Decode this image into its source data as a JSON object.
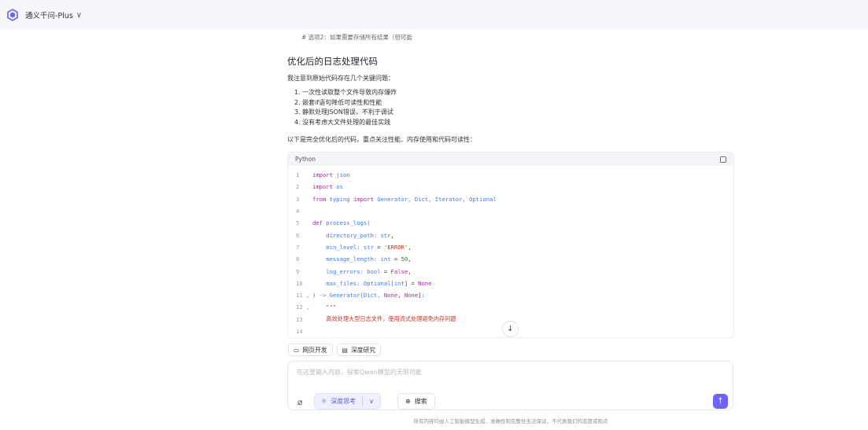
{
  "header": {
    "model_name": "通义千问-Plus",
    "colors": {
      "accent": "#6d64f5",
      "topbar": "#f6f7fb"
    }
  },
  "chat": {
    "faded_line": "# 选项2：如果需要存储所有结果（但可能",
    "heading": "优化后的日志处理代码",
    "intro": "我注意到原始代码存在几个关键问题：",
    "issues": [
      "1. 一次性读取整个文件导致内存爆炸",
      "2. 嵌套if语句降低可读性和性能",
      "3. 静默处理JSON错误，不利于调试",
      "4. 没有考虑大文件处理的最佳实践"
    ],
    "summary": "以下是完全优化后的代码，重点关注性能、内存使用和代码可读性："
  },
  "code": {
    "language": "Python",
    "lines": [
      {
        "no": "1",
        "parts": [
          {
            "t": "import",
            "c": "kw"
          },
          {
            "t": " json",
            "c": "ty"
          }
        ]
      },
      {
        "no": "2",
        "parts": [
          {
            "t": "import",
            "c": "kw"
          },
          {
            "t": " os",
            "c": "ty"
          }
        ]
      },
      {
        "no": "3",
        "parts": [
          {
            "t": "from",
            "c": "kw"
          },
          {
            "t": " typing ",
            "c": "ty"
          },
          {
            "t": "import",
            "c": "kw"
          },
          {
            "t": " Generator, Dict, Iterator, Optional",
            "c": "ty"
          }
        ]
      },
      {
        "no": "4",
        "parts": []
      },
      {
        "no": "5",
        "parts": [
          {
            "t": "def",
            "c": "kw"
          },
          {
            "t": " process_logs(",
            "c": "ty"
          }
        ]
      },
      {
        "no": "6",
        "parts": [
          {
            "t": "    directory_path: ",
            "c": "ty"
          },
          {
            "t": "str",
            "c": "ty"
          },
          {
            "t": ",",
            "c": "tx"
          }
        ]
      },
      {
        "no": "7",
        "parts": [
          {
            "t": "    min_level: ",
            "c": "ty"
          },
          {
            "t": "str",
            "c": "ty"
          },
          {
            "t": " = ",
            "c": "tx"
          },
          {
            "t": "'ERROR'",
            "c": "st"
          },
          {
            "t": ",",
            "c": "tx"
          }
        ]
      },
      {
        "no": "8",
        "parts": [
          {
            "t": "    message_length: ",
            "c": "ty"
          },
          {
            "t": "int",
            "c": "ty"
          },
          {
            "t": " = ",
            "c": "tx"
          },
          {
            "t": "50",
            "c": "nm"
          },
          {
            "t": ",",
            "c": "tx"
          }
        ]
      },
      {
        "no": "9",
        "parts": [
          {
            "t": "    log_errors: ",
            "c": "ty"
          },
          {
            "t": "bool",
            "c": "ty"
          },
          {
            "t": " = ",
            "c": "tx"
          },
          {
            "t": "False",
            "c": "kw"
          },
          {
            "t": ",",
            "c": "tx"
          }
        ]
      },
      {
        "no": "10",
        "parts": [
          {
            "t": "    max_files: Optional[",
            "c": "ty"
          },
          {
            "t": "int",
            "c": "ty"
          },
          {
            "t": "] = ",
            "c": "tx"
          },
          {
            "t": "None",
            "c": "kw"
          }
        ]
      },
      {
        "no": "11 ⌄",
        "parts": [
          {
            "t": ") -> Generator[Dict, ",
            "c": "ty"
          },
          {
            "t": "None",
            "c": "kw"
          },
          {
            "t": ", ",
            "c": "tx"
          },
          {
            "t": "None",
            "c": "kw"
          },
          {
            "t": "]:",
            "c": "tx"
          }
        ]
      },
      {
        "no": "12 ⌄",
        "parts": [
          {
            "t": "    \"\"\"",
            "c": "st"
          }
        ]
      },
      {
        "no": "13",
        "parts": [
          {
            "t": "    高效处理大型日志文件，使用流式处理避免内存问题",
            "c": "cm"
          }
        ]
      },
      {
        "no": "14",
        "parts": []
      }
    ]
  },
  "chips": [
    {
      "label": "网页开发",
      "icon": "monitor-icon"
    },
    {
      "label": "深度研究",
      "icon": "document-icon"
    }
  ],
  "input": {
    "placeholder": "在这里输入内容，探索Qwen模型的无限可能",
    "deep_think_label": "深度思考",
    "search_label": "搜索"
  },
  "footer": {
    "disclaimer": "所有内容均由人工智能模型生成，准确性和完整性无法保证，不代表我们的态度或观点"
  }
}
